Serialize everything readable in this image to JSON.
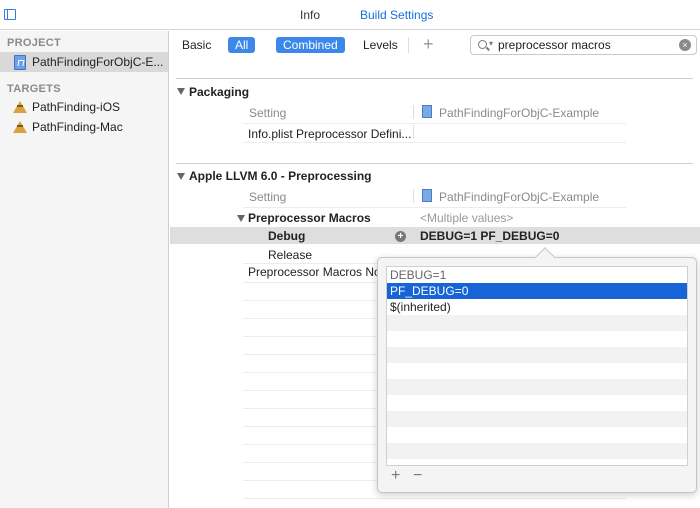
{
  "tabs": {
    "info": "Info",
    "build_settings": "Build Settings"
  },
  "sidebar": {
    "project_header": "PROJECT",
    "project_item": "PathFindingForObjC-E...",
    "targets_header": "TARGETS",
    "targets": [
      "PathFinding-iOS",
      "PathFinding-Mac"
    ]
  },
  "filter": {
    "basic": "Basic",
    "all": "All",
    "combined": "Combined",
    "levels": "Levels",
    "add": "+"
  },
  "search": {
    "value": "preprocessor macros",
    "clear": "×"
  },
  "packaging": {
    "title": "Packaging",
    "col_setting": "Setting",
    "col_target": "PathFindingForObjC-Example",
    "row": "Info.plist Preprocessor Defini..."
  },
  "llvm": {
    "title": "Apple LLVM 6.0 - Preprocessing",
    "col_setting": "Setting",
    "col_target": "PathFindingForObjC-Example",
    "macros_label": "Preprocessor Macros",
    "macros_value": "<Multiple values>",
    "debug_label": "Debug",
    "debug_value": "DEBUG=1 PF_DEBUG=0",
    "release_label": "Release",
    "not_used_label": "Preprocessor Macros No"
  },
  "popover": {
    "items": [
      "DEBUG=1",
      "PF_DEBUG=0",
      "$(inherited)"
    ],
    "add": "+",
    "remove": "−"
  }
}
